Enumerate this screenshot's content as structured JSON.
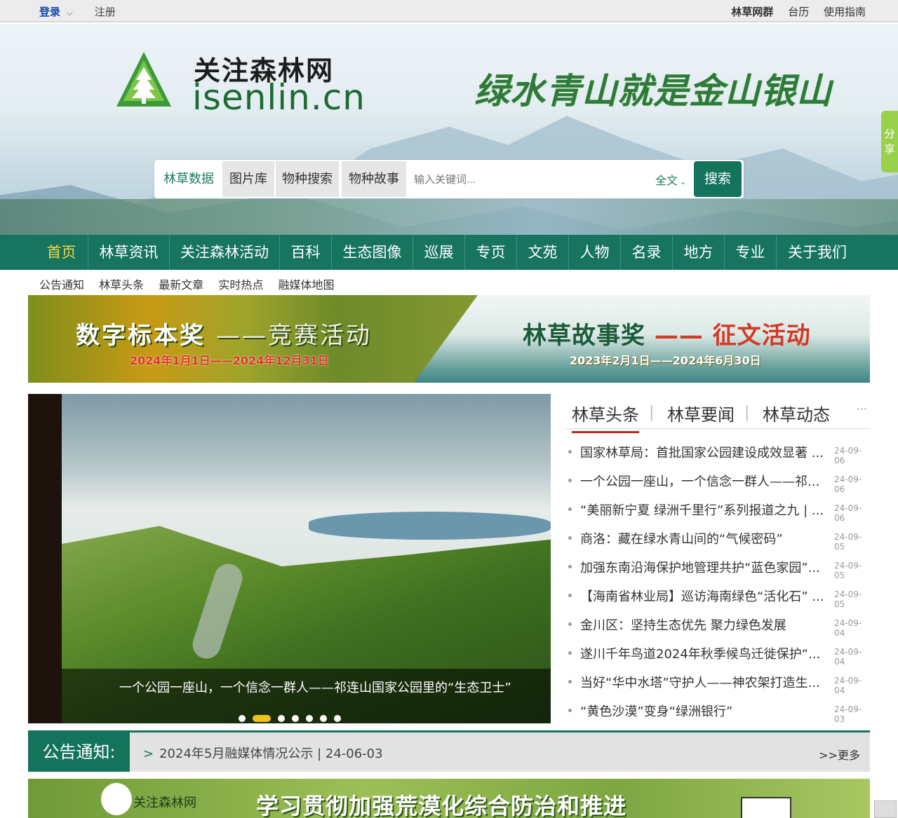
{
  "topbar": {
    "login": "登录",
    "register": "注册",
    "links": [
      "林草网群",
      "台历",
      "使用指南"
    ]
  },
  "header": {
    "site_name": "关注森林网",
    "domain": "isenlin.cn",
    "slogan": "绿水青山就是金山银山",
    "share": [
      "分",
      "享"
    ]
  },
  "search": {
    "tabs": [
      "林草数据",
      "图片库",
      "物种搜索",
      "物种故事"
    ],
    "placeholder": "输入关键词...",
    "scope": "全文",
    "button": "搜索"
  },
  "nav": {
    "items": [
      "首页",
      "林草资讯",
      "关注森林活动",
      "百科",
      "生态图像",
      "巡展",
      "专页",
      "文苑",
      "人物",
      "名录",
      "地方",
      "专业",
      "关于我们"
    ],
    "active": "首页"
  },
  "subnav": [
    "公告通知",
    "林草头条",
    "最新文章",
    "实时热点",
    "融媒体地图"
  ],
  "banner": {
    "left_title": "数字标本奖",
    "left_sub": "——竞赛活动",
    "left_dates": "2024年1月1日——2024年12月31日",
    "right_title": "林草故事奖",
    "right_sub": "—— 征文活动",
    "right_dates": "2023年2月1日——2024年6月30日"
  },
  "carousel": {
    "caption": "一个公园一座山，一个信念一群人——祁连山国家公园里的“生态卫士”",
    "slides": 7,
    "active_slide": 2
  },
  "news": {
    "tabs": [
      "林草头条",
      "林草要闻",
      "林草动态"
    ],
    "more": "···",
    "items": [
      {
        "title": "国家林草局：首批国家公园建设成效显著 ...",
        "date": "24-09-06"
      },
      {
        "title": "一个公园一座山，一个信念一群人——祁...",
        "date": "24-09-06"
      },
      {
        "title": "“美丽新宁夏 绿洲千里行”系列报道之九 | ...",
        "date": "24-09-06"
      },
      {
        "title": "商洛：藏在绿水青山间的“气候密码”",
        "date": "24-09-05"
      },
      {
        "title": "加强东南沿海保护地管理共护“蓝色家园”...",
        "date": "24-09-05"
      },
      {
        "title": "【海南省林业局】巡访海南绿色“活化石” ...",
        "date": "24-09-05"
      },
      {
        "title": "金川区：坚持生态优先 聚力绿色发展",
        "date": "24-09-04"
      },
      {
        "title": "遂川千年鸟道2024年秋季候鸟迁徙保护“...",
        "date": "24-09-04"
      },
      {
        "title": "当好“华中水塔”守护人——神农架打造生...",
        "date": "24-09-04"
      },
      {
        "title": "“黄色沙漠”变身“绿洲银行”",
        "date": "24-09-03"
      }
    ]
  },
  "notice": {
    "label": "公告通知:",
    "marker": ">",
    "item": "2024年5月融媒体情况公示 | 24-06-03",
    "more": ">>更多"
  },
  "bottom_banner": {
    "name": "关注森林网",
    "text": "学习贯彻加强荒漠化综合防治和推进"
  },
  "colors": {
    "brand": "#14735d",
    "accent": "#f4d64a",
    "highlight": "#b92b21"
  }
}
